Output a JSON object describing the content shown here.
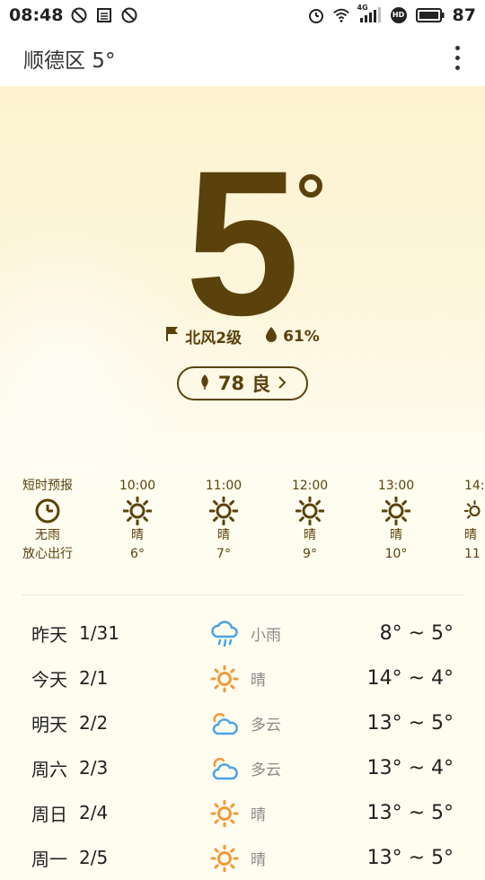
{
  "status_bar": {
    "time": "08:48",
    "net_label": "4G",
    "hd_label": "HD",
    "battery": "87"
  },
  "appbar": {
    "title": "顺德区 5°"
  },
  "current": {
    "temp": "5",
    "wind": "北风2级",
    "humidity": "61%",
    "aqi_value": "78",
    "aqi_level": "良"
  },
  "hourly": [
    {
      "time": "短时预报",
      "cond": "无雨",
      "extra": "放心出行",
      "icon": "clock-icon"
    },
    {
      "time": "10:00",
      "cond": "晴",
      "extra": "6°",
      "icon": "sun-icon"
    },
    {
      "time": "11:00",
      "cond": "晴",
      "extra": "7°",
      "icon": "sun-icon"
    },
    {
      "time": "12:00",
      "cond": "晴",
      "extra": "9°",
      "icon": "sun-icon"
    },
    {
      "time": "13:00",
      "cond": "晴",
      "extra": "10°",
      "icon": "sun-icon"
    },
    {
      "time": "14:",
      "cond": "晴",
      "extra": "11",
      "icon": "sun-icon"
    }
  ],
  "daily": [
    {
      "day": "昨天",
      "date": "1/31",
      "cond": "小雨",
      "range": "8° ~ 5°",
      "icon": "rain-icon"
    },
    {
      "day": "今天",
      "date": "2/1",
      "cond": "晴",
      "range": "14° ~ 4°",
      "icon": "sun-icon"
    },
    {
      "day": "明天",
      "date": "2/2",
      "cond": "多云",
      "range": "13° ~ 5°",
      "icon": "partly-cloudy-icon"
    },
    {
      "day": "周六",
      "date": "2/3",
      "cond": "多云",
      "range": "13° ~ 4°",
      "icon": "partly-cloudy-icon"
    },
    {
      "day": "周日",
      "date": "2/4",
      "cond": "晴",
      "range": "13° ~ 5°",
      "icon": "sun-icon"
    },
    {
      "day": "周一",
      "date": "2/5",
      "cond": "晴",
      "range": "13° ~ 5°",
      "icon": "sun-icon"
    }
  ],
  "colors": {
    "primary_text": "#5b420c",
    "sun_orange": "#f29a38",
    "cloud_blue": "#4aa3e4"
  }
}
